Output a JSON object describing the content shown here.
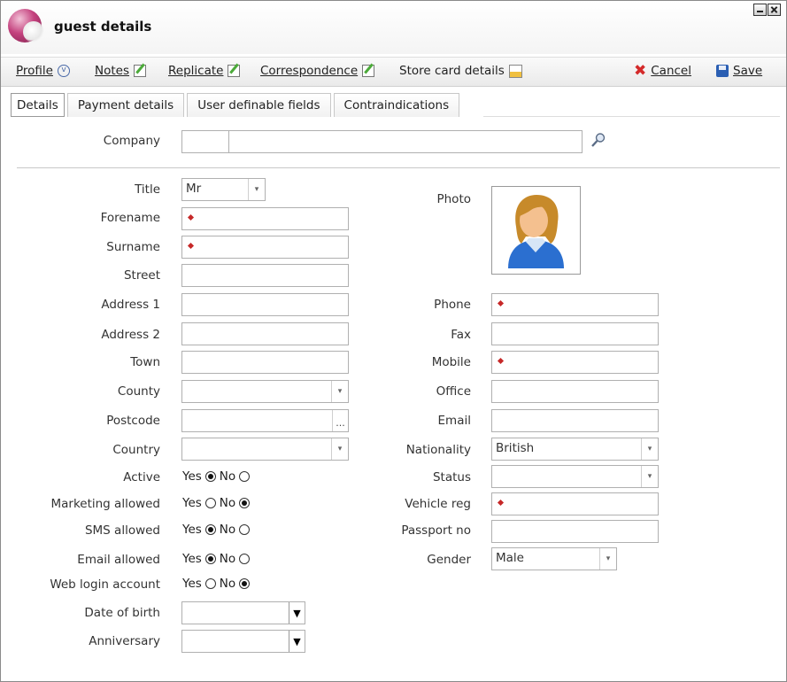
{
  "window": {
    "title": "guest details"
  },
  "toolbar": {
    "profile": "Profile",
    "notes": "Notes",
    "replicate": "Replicate",
    "correspondence": "Correspondence",
    "store_card": "Store card details",
    "cancel": "Cancel",
    "save": "Save"
  },
  "tabs": [
    "Details",
    "Payment details",
    "User definable fields",
    "Contraindications"
  ],
  "company": {
    "label": "Company",
    "code": "",
    "name": ""
  },
  "left": {
    "title": {
      "label": "Title",
      "value": "Mr"
    },
    "forename": {
      "label": "Forename",
      "value": ""
    },
    "surname": {
      "label": "Surname",
      "value": ""
    },
    "street": {
      "label": "Street",
      "value": ""
    },
    "address1": {
      "label": "Address 1",
      "value": ""
    },
    "address2": {
      "label": "Address 2",
      "value": ""
    },
    "town": {
      "label": "Town",
      "value": ""
    },
    "county": {
      "label": "County",
      "value": ""
    },
    "postcode": {
      "label": "Postcode",
      "value": ""
    },
    "country": {
      "label": "Country",
      "value": ""
    },
    "date_of_birth": {
      "label": "Date of birth",
      "value": ""
    },
    "anniversary": {
      "label": "Anniversary",
      "value": ""
    }
  },
  "radios": {
    "yes": "Yes",
    "no": "No",
    "active": {
      "label": "Active",
      "value": "Yes"
    },
    "marketing": {
      "label": "Marketing allowed",
      "value": "No"
    },
    "sms": {
      "label": "SMS allowed",
      "value": "Yes"
    },
    "email": {
      "label": "Email allowed",
      "value": "Yes"
    },
    "weblogin": {
      "label": "Web login account",
      "value": "No"
    }
  },
  "right": {
    "photo": {
      "label": "Photo"
    },
    "phone": {
      "label": "Phone",
      "value": ""
    },
    "fax": {
      "label": "Fax",
      "value": ""
    },
    "mobile": {
      "label": "Mobile",
      "value": ""
    },
    "office": {
      "label": "Office",
      "value": ""
    },
    "email": {
      "label": "Email",
      "value": ""
    },
    "nationality": {
      "label": "Nationality",
      "value": "British"
    },
    "status": {
      "label": "Status",
      "value": ""
    },
    "vehicle_reg": {
      "label": "Vehicle reg",
      "value": ""
    },
    "passport_no": {
      "label": "Passport no",
      "value": ""
    },
    "gender": {
      "label": "Gender",
      "value": "Male"
    }
  },
  "colors": {
    "required_marker": "#c62828",
    "window_border": "#8a8a8a",
    "accent_blue": "#2b5fb3"
  }
}
